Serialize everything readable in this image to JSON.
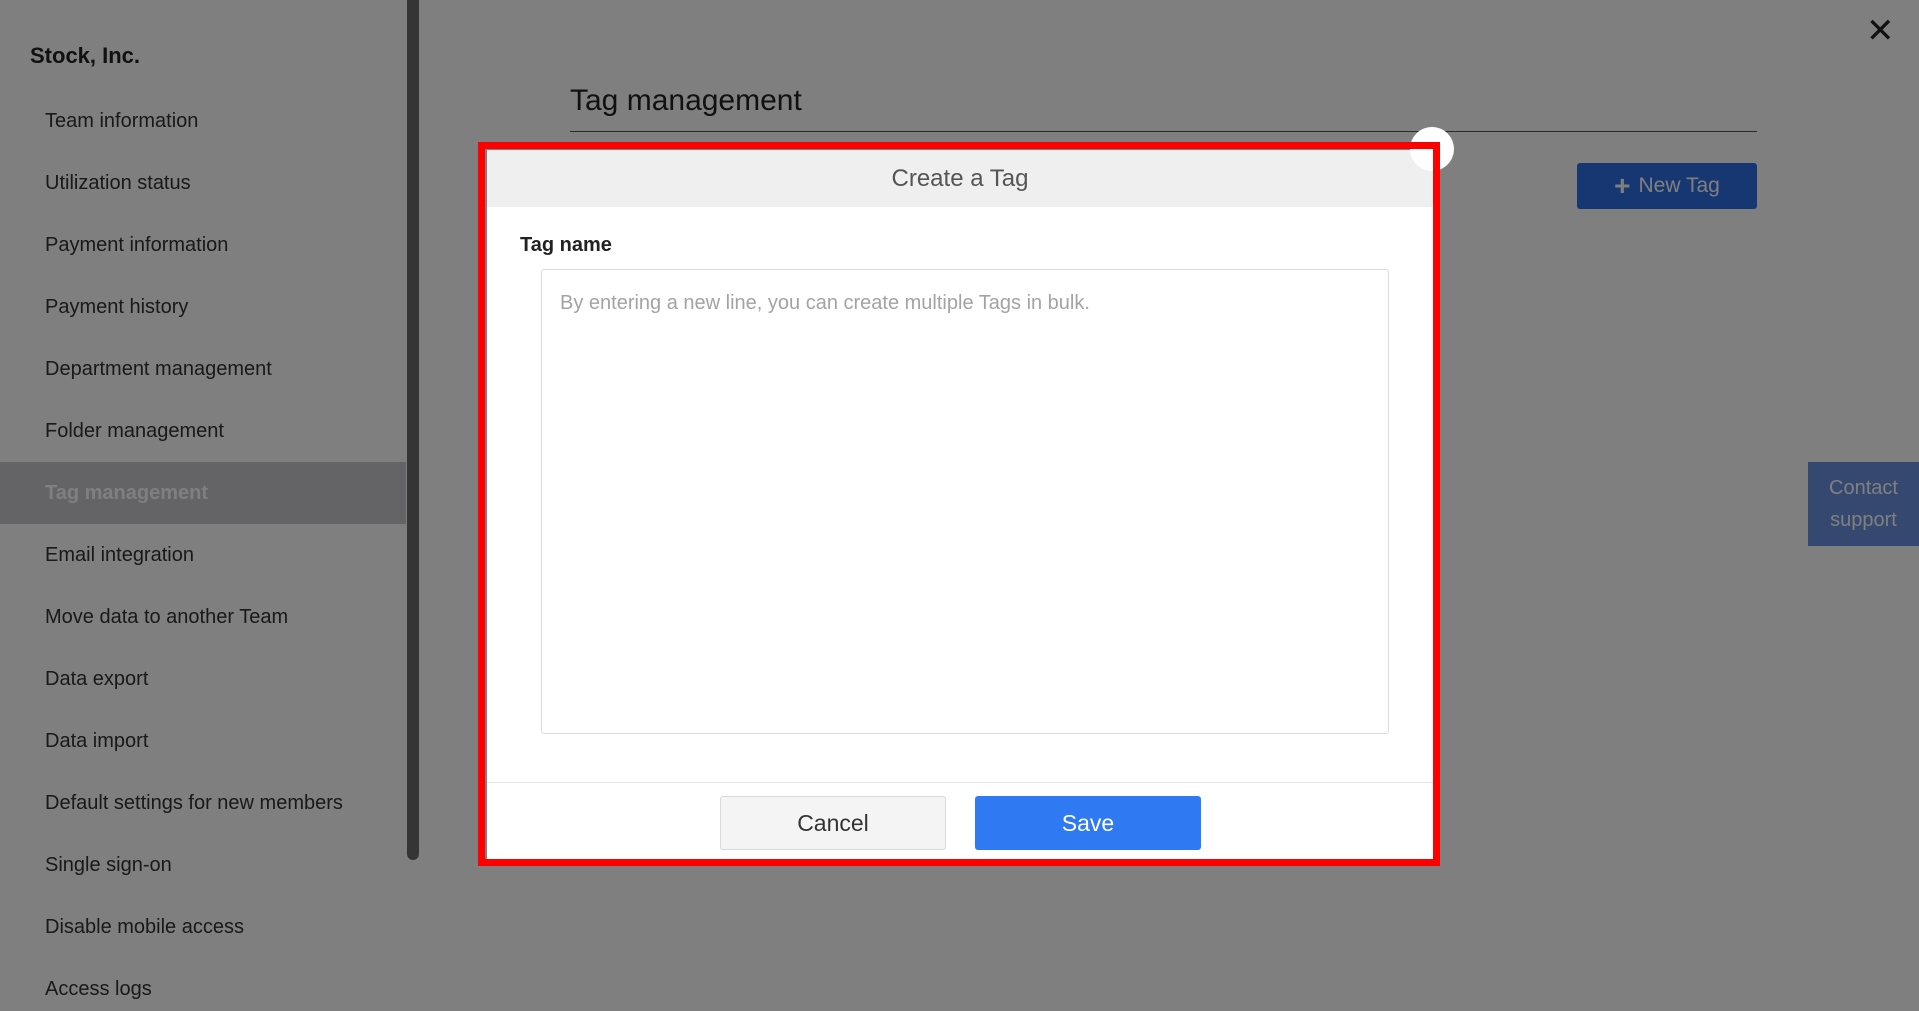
{
  "sidebar": {
    "company": "Stock, Inc.",
    "items": [
      {
        "label": "Team information"
      },
      {
        "label": "Utilization status"
      },
      {
        "label": "Payment information"
      },
      {
        "label": "Payment history"
      },
      {
        "label": "Department management"
      },
      {
        "label": "Folder management"
      },
      {
        "label": "Tag management",
        "active": true
      },
      {
        "label": "Email integration"
      },
      {
        "label": "Move data to another Team"
      },
      {
        "label": "Data export"
      },
      {
        "label": "Data import"
      },
      {
        "label": "Default settings for new members"
      },
      {
        "label": "Single sign-on"
      },
      {
        "label": "Disable mobile access"
      },
      {
        "label": "Access logs"
      }
    ]
  },
  "main": {
    "title": "Tag management",
    "new_tag_label": "New Tag",
    "new_tag_icon": "plus-icon",
    "close_icon": "close-icon",
    "close_glyph": "✕"
  },
  "contact": {
    "line1": "Contact",
    "line2": "support"
  },
  "modal": {
    "title": "Create a Tag",
    "field_label": "Tag name",
    "placeholder": "By entering a new line, you can create multiple Tags in bulk.",
    "value": "",
    "cancel_label": "Cancel",
    "save_label": "Save"
  },
  "colors": {
    "primary": "#2f6fe4",
    "save": "#2f79f2",
    "highlight": "#ff0000"
  }
}
